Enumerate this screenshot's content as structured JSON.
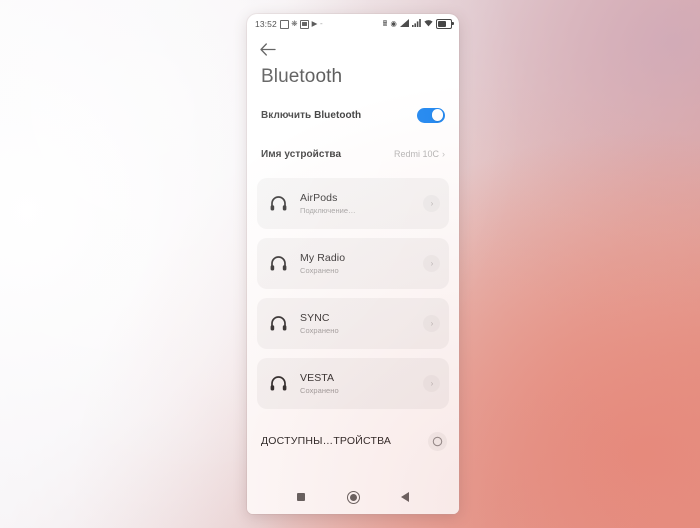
{
  "wallpaper": {
    "description": "soft gradient backdrop",
    "color_left": "#fdfdfe",
    "color_right_bottom": "#e68b7d",
    "color_right_top": "#cdaaba"
  },
  "phone": {
    "status_bar": {
      "clock": "13:52",
      "left_icons": [
        "calendar-icon",
        "bug-icon",
        "screenshot-icon",
        "play-icon",
        "dash-icon"
      ],
      "right_icons": [
        "bluetooth-icon",
        "alarm-icon",
        "signal-1-icon",
        "signal-2-icon",
        "wifi-icon",
        "battery-icon"
      ]
    },
    "topbar": {
      "back_icon": "back-arrow-icon"
    },
    "page_title": "Bluetooth",
    "settings": [
      {
        "label": "Включить Bluetooth",
        "control": "toggle",
        "enabled": true
      },
      {
        "label": "Имя устройства",
        "control": "value",
        "value": "Redmi 10C",
        "chevron": "›"
      }
    ],
    "devices": [
      {
        "name": "AirPods",
        "status": "Подключение…",
        "icon": "headphones-icon",
        "chevron": "›"
      },
      {
        "name": "My Radio",
        "status": "Сохранено",
        "icon": "headphones-icon",
        "chevron": "›"
      },
      {
        "name": "SYNC",
        "status": "Сохранено",
        "icon": "headphones-icon",
        "chevron": "›"
      },
      {
        "name": "VESTA",
        "status": "Сохранено",
        "icon": "headphones-icon",
        "chevron": "›"
      }
    ],
    "available_section": {
      "title": "ДОСТУПНЫ…ТРОЙСТВА",
      "refresh_icon": "refresh-spinner-icon"
    },
    "navbar": {
      "recents": "recents-square-icon",
      "home": "home-circle-icon",
      "back": "back-triangle-icon"
    }
  },
  "colors": {
    "accent_blue": "#1280f0",
    "card_gray": "#f4f4f4",
    "text_primary": "#222222",
    "text_secondary": "#9a9a9a"
  }
}
